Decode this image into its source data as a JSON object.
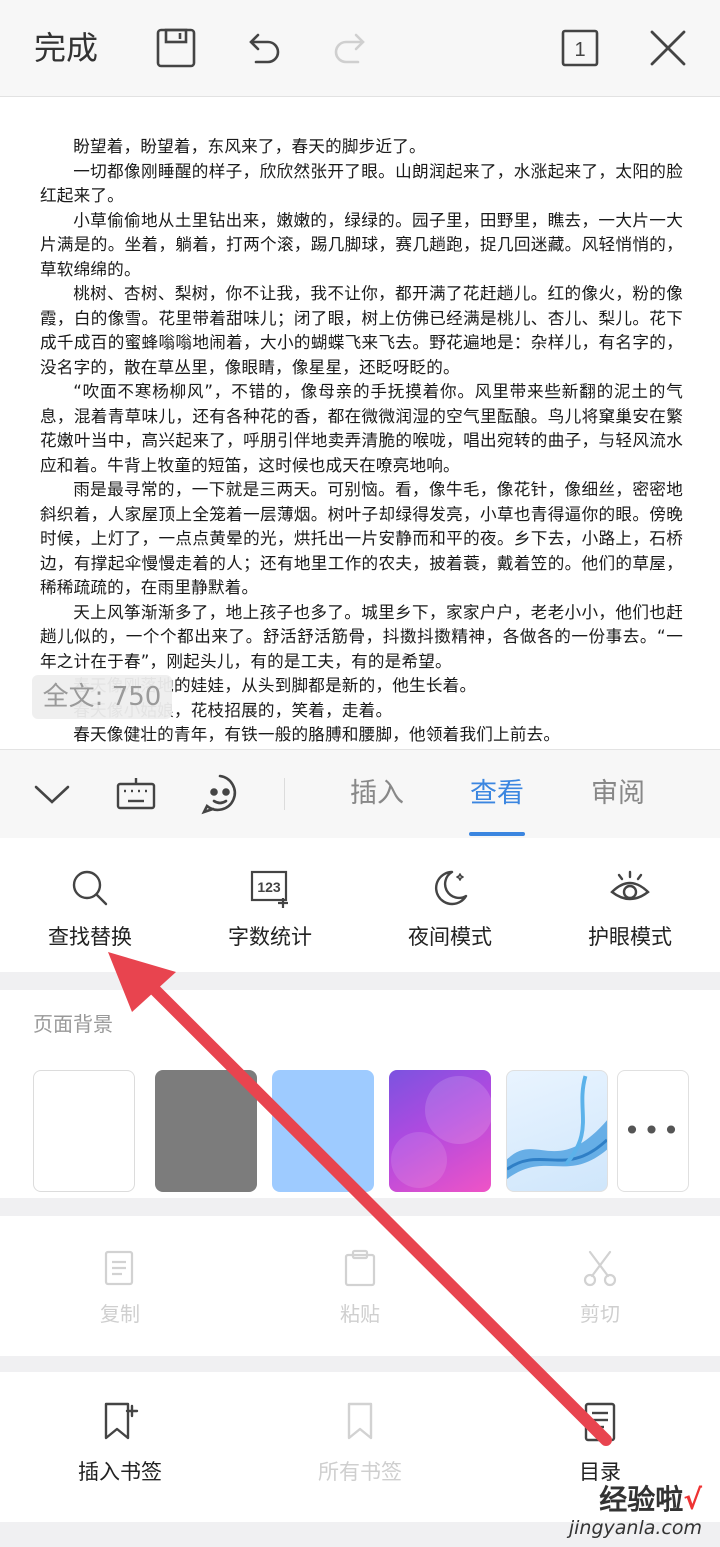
{
  "topbar": {
    "done_label": "完成",
    "page_count": "1"
  },
  "document": {
    "paragraphs": [
      "盼望着，盼望着，东风来了，春天的脚步近了。",
      "一切都像刚睡醒的样子，欣欣然张开了眼。山朗润起来了，水涨起来了，太阳的脸红起来了。",
      "小草偷偷地从土里钻出来，嫩嫩的，绿绿的。园子里，田野里，瞧去，一大片一大片满是的。坐着，躺着，打两个滚，踢几脚球，赛几趟跑，捉几回迷藏。风轻悄悄的，草软绵绵的。",
      "桃树、杏树、梨树，你不让我，我不让你，都开满了花赶趟儿。红的像火，粉的像霞，白的像雪。花里带着甜味儿；闭了眼，树上仿佛已经满是桃儿、杏儿、梨儿。花下成千成百的蜜蜂嗡嗡地闹着，大小的蝴蝶飞来飞去。野花遍地是：杂样儿，有名字的，没名字的，散在草丛里，像眼睛，像星星，还眨呀眨的。",
      "“吹面不寒杨柳风”，不错的，像母亲的手抚摸着你。风里带来些新翻的泥土的气息，混着青草味儿，还有各种花的香，都在微微润湿的空气里酝酿。鸟儿将窠巢安在繁花嫩叶当中，高兴起来了，呼朋引伴地卖弄清脆的喉咙，唱出宛转的曲子，与轻风流水应和着。牛背上牧童的短笛，这时候也成天在嘹亮地响。",
      "雨是最寻常的，一下就是三两天。可别恼。看，像牛毛，像花针，像细丝，密密地斜织着，人家屋顶上全笼着一层薄烟。树叶子却绿得发亮，小草也青得逼你的眼。傍晚时候，上灯了，一点点黄晕的光，烘托出一片安静而和平的夜。乡下去，小路上，石桥边，有撑起伞慢慢走着的人；还有地里工作的农夫，披着蓑，戴着笠的。他们的草屋，稀稀疏疏的，在雨里静默着。",
      "天上风筝渐渐多了，地上孩子也多了。城里乡下，家家户户，老老小小，他们也赶趟儿似的，一个个都出来了。舒活舒活筋骨，抖擞抖擞精神，各做各的一份事去。“一年之计在于春”，刚起头儿，有的是工夫，有的是希望。",
      "春天像刚落地的娃娃，从头到脚都是新的，他生长着。",
      "春天像小姑娘，花枝招展的，笑着，走着。",
      "春天像健壮的青年，有铁一般的胳膊和腰脚，他领着我们上前去。"
    ],
    "word_count_label": "全文: 750"
  },
  "tabs": [
    {
      "label": "插入"
    },
    {
      "label": "查看"
    },
    {
      "label": "审阅"
    }
  ],
  "view_functions": [
    {
      "label": "查找替换"
    },
    {
      "label": "字数统计"
    },
    {
      "label": "夜间模式"
    },
    {
      "label": "护眼模式"
    }
  ],
  "page_background": {
    "label": "页面背景"
  },
  "edit_actions": [
    {
      "label": "复制"
    },
    {
      "label": "粘贴"
    },
    {
      "label": "剪切"
    }
  ],
  "bookmarks": [
    {
      "label": "插入书签"
    },
    {
      "label": "所有书签"
    },
    {
      "label": "目录"
    }
  ],
  "watermark": {
    "main": "经验啦",
    "check": "√",
    "url": "jingyanla.com"
  },
  "colors": {
    "accent": "#3b86e0",
    "arrow": "#e8444f"
  }
}
